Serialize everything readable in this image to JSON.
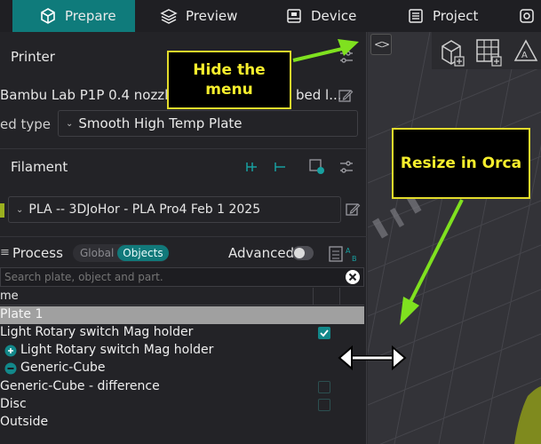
{
  "tabs": {
    "prepare": "Prepare",
    "preview": "Preview",
    "device": "Device",
    "project": "Project"
  },
  "printer": {
    "title": "Printer",
    "name": "Bambu Lab P1P 0.4 nozzle -",
    "name_suffix": "bed l...",
    "bed_type_label": "ed type",
    "bed_type_value": "Smooth High Temp Plate"
  },
  "filament": {
    "title": "Filament",
    "selected": "PLA -- 3DJoHor - PLA Pro4 Feb 1 2025",
    "swatch_color": "#9bb01f"
  },
  "process": {
    "title": "Process",
    "seg_global": "Global",
    "seg_objects": "Objects",
    "advanced_label": "Advanced",
    "advanced_on": false
  },
  "search": {
    "placeholder": "Search plate, object and part."
  },
  "object_list": {
    "header_name": "me",
    "plate": "Plate 1",
    "rows": [
      {
        "label": "Light Rotary switch Mag holder",
        "checked": true
      },
      {
        "label": "Light Rotary switch Mag holder",
        "badge": "plus"
      },
      {
        "label": "Generic-Cube",
        "badge": "minus"
      },
      {
        "label": "Generic-Cube - difference",
        "checked": false
      },
      {
        "label": "Disc",
        "checked": false
      },
      {
        "label": "Outside"
      }
    ]
  },
  "callouts": {
    "hide_menu": "Hide the\nmenu",
    "resize": "Resize in Orca"
  },
  "colors": {
    "accent": "#0f7b7b",
    "arrow": "#7fe11f",
    "callout_text": "#f6ee2d"
  }
}
